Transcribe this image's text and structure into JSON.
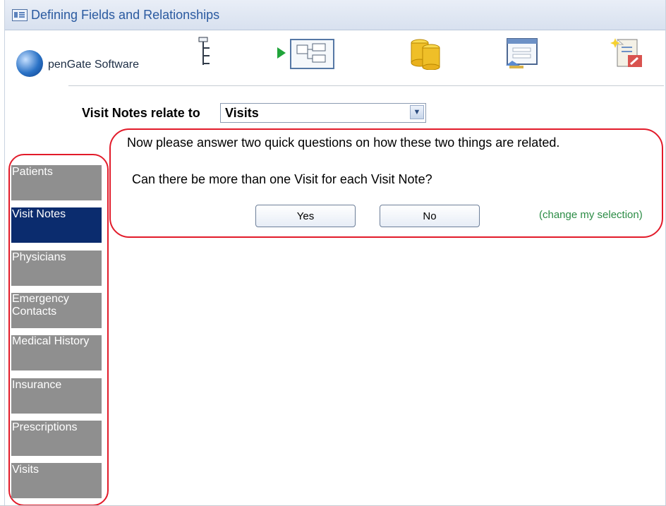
{
  "window": {
    "title": "Defining Fields and Relationships"
  },
  "toolbar": {
    "logo_text": "penGate Software",
    "icons": [
      "fields-tree-icon",
      "relationships-icon",
      "database-icon",
      "form-icon",
      "report-icon"
    ]
  },
  "relate": {
    "label": "Visit Notes relate to",
    "selected_value": "Visits"
  },
  "question_panel": {
    "intro": "Now please answer two quick questions on how these two things are related.",
    "question": "Can there be more than one Visit for each Visit Note?",
    "yes_label": "Yes",
    "no_label": "No",
    "change_link": "(change my selection)"
  },
  "sidebar": {
    "items": [
      {
        "label": "Patients"
      },
      {
        "label": "Visit Notes"
      },
      {
        "label": "Physicians"
      },
      {
        "label": "Emergency Contacts"
      },
      {
        "label": "Medical History"
      },
      {
        "label": "Insurance"
      },
      {
        "label": "Prescriptions"
      },
      {
        "label": "Visits"
      }
    ],
    "active_index": 1
  },
  "colors": {
    "accent_red": "#e21b2a",
    "active_nav": "#0b2c6e",
    "nav_gray": "#8f8f8f",
    "link_green": "#2b8c45",
    "title_blue": "#2a5aa0"
  }
}
